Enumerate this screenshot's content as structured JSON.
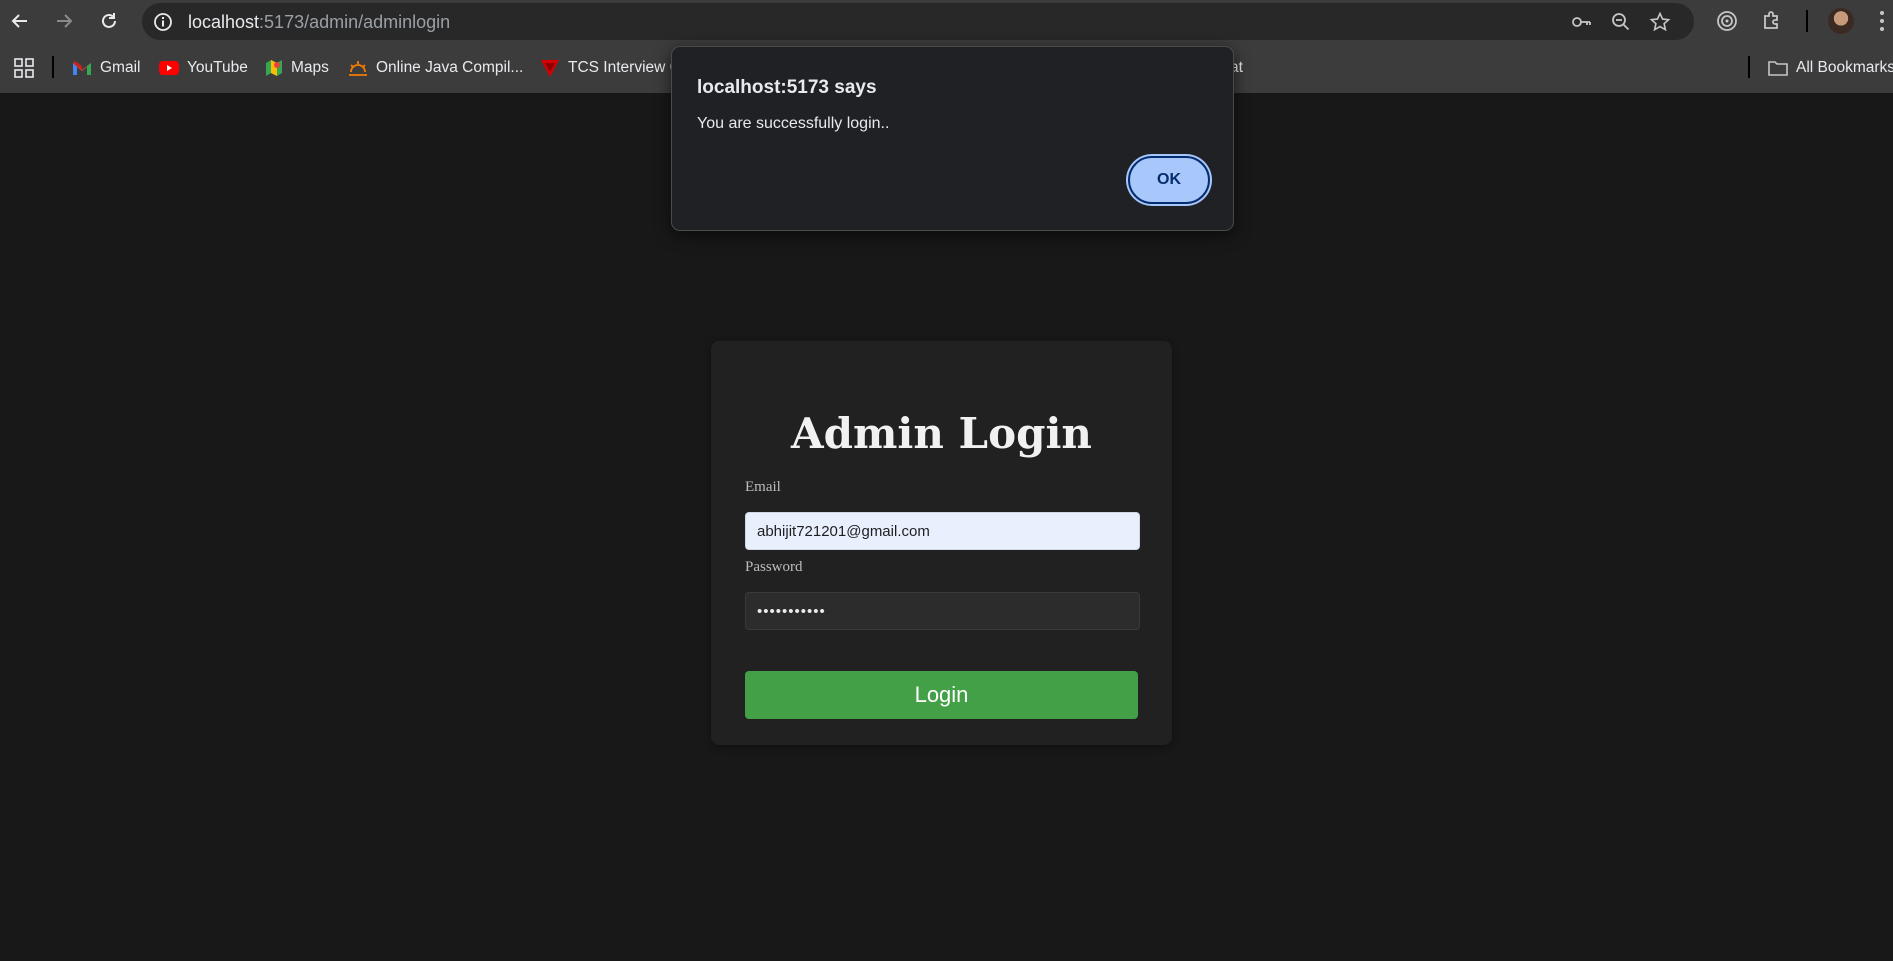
{
  "browser": {
    "url_host": "localhost",
    "url_path": ":5173/admin/adminlogin"
  },
  "bookmarks": {
    "items": [
      {
        "label": "Gmail",
        "icon": "gmail-icon"
      },
      {
        "label": "YouTube",
        "icon": "youtube-icon"
      },
      {
        "label": "Maps",
        "icon": "maps-icon"
      },
      {
        "label": "Online Java Compil...",
        "icon": "java-compiler-icon"
      },
      {
        "label": "TCS Interview Q",
        "icon": "tcs-icon"
      },
      {
        "label": "at",
        "icon": ""
      }
    ],
    "all_bookmarks_label": "All Bookmarks"
  },
  "dialog": {
    "title": "localhost:5173 says",
    "message": "You are successfully login..",
    "ok_label": "OK"
  },
  "login": {
    "title": "Admin Login",
    "email_label": "Email",
    "email_value": "abhijit721201@gmail.com",
    "password_label": "Password",
    "password_value": "•••••••••••",
    "button_label": "Login"
  },
  "colors": {
    "page_bg": "#181818",
    "card_bg": "#212121",
    "login_button": "#43a047",
    "ok_button": "#a8c7fa",
    "chrome_bar": "#3c3c3c"
  }
}
